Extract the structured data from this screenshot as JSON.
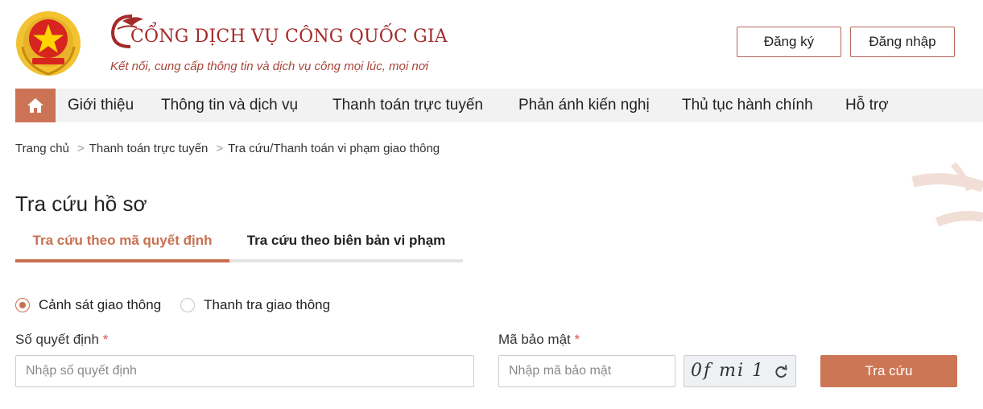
{
  "header": {
    "title": "CỔNG DỊCH VỤ CÔNG QUỐC GIA",
    "tagline": "Kết nối, cung cấp thông tin và dịch vụ công mọi lúc, mọi nơi",
    "register_label": "Đăng ký",
    "login_label": "Đăng nhập",
    "logo_icon": "national-emblem-icon"
  },
  "nav": {
    "home_icon": "home-icon",
    "items": [
      {
        "label": "Giới thiệu"
      },
      {
        "label": "Thông tin và dịch vụ"
      },
      {
        "label": "Thanh toán trực tuyến"
      },
      {
        "label": "Phản ánh kiến nghị"
      },
      {
        "label": "Thủ tục hành chính"
      },
      {
        "label": "Hỗ trợ"
      }
    ]
  },
  "breadcrumb": {
    "separator": ">",
    "items": [
      {
        "label": "Trang chủ"
      },
      {
        "label": "Thanh toán trực tuyến"
      },
      {
        "label": "Tra cứu/Thanh toán vi phạm giao thông"
      }
    ]
  },
  "page": {
    "title": "Tra cứu hồ sơ",
    "tabs": [
      {
        "label": "Tra cứu theo mã quyết định",
        "active": true
      },
      {
        "label": "Tra cứu theo biên bản vi phạm",
        "active": false
      }
    ]
  },
  "form": {
    "agency_options": [
      {
        "label": "Cảnh sát giao thông",
        "checked": true
      },
      {
        "label": "Thanh tra giao thông",
        "checked": false
      }
    ],
    "decision_label": "Số quyết định",
    "decision_placeholder": "Nhập số quyết định",
    "decision_value": "",
    "captcha_label": "Mã bảo mật",
    "captcha_placeholder": "Nhập mã bảo mật",
    "captcha_value": "",
    "captcha_text": "0f mi 1",
    "required_marker": "*",
    "submit_label": "Tra cứu"
  },
  "colors": {
    "accent": "#c8704f",
    "title_red": "#a52a2a",
    "nav_bg": "#f2f2f2",
    "required": "#d9534f"
  }
}
